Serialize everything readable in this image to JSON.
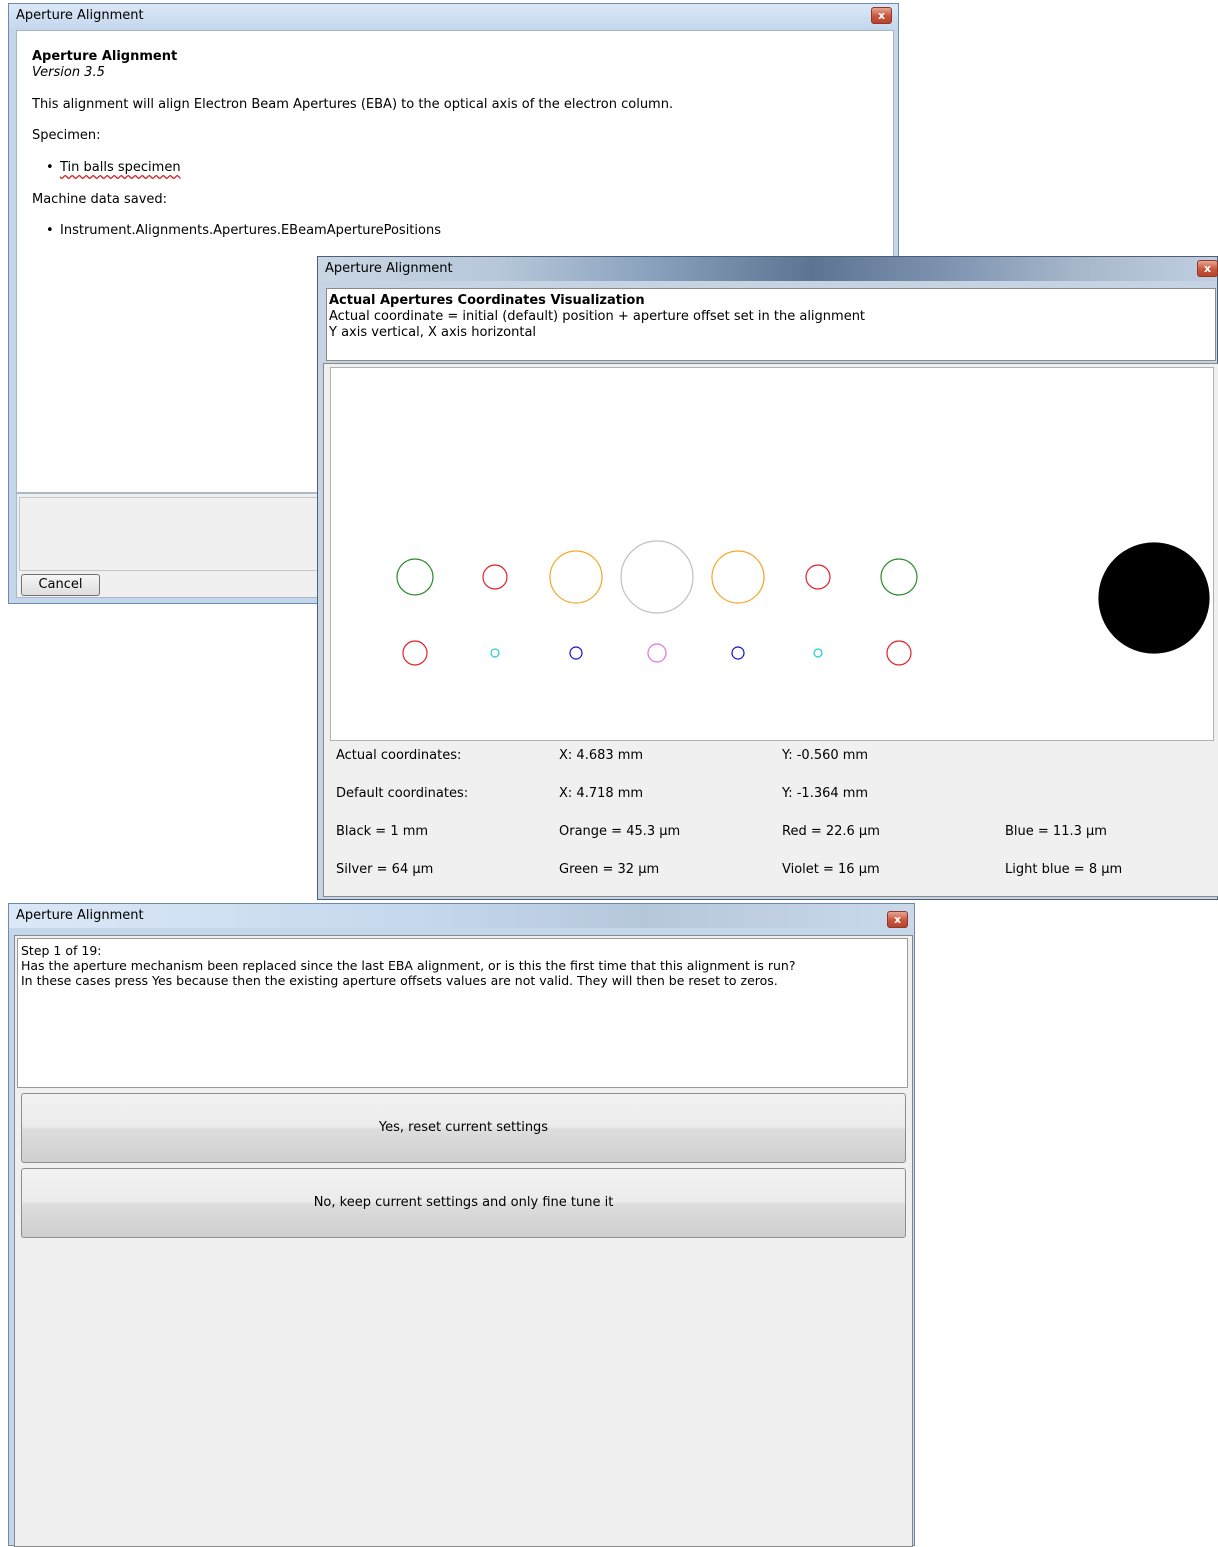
{
  "window1": {
    "title": "Aperture Alignment",
    "close_glyph": "x",
    "heading": "Aperture Alignment",
    "version": "Version 3.5",
    "description": "This alignment will align Electron Beam Apertures (EBA) to the optical axis of the electron column.",
    "specimen_label": "Specimen:",
    "specimen_item": "Tin balls specimen",
    "machine_data_label": "Machine data saved:",
    "machine_data_item": "Instrument.Alignments.Apertures.EBeamAperturePositions",
    "cancel_label": "Cancel"
  },
  "window2": {
    "title": "Aperture Alignment",
    "close_glyph": "x",
    "header_title": "Actual Apertures Coordinates Visualization",
    "header_line1": "Actual coordinate = initial (default) position + aperture offset set in the alignment",
    "header_line2": "Y axis vertical, X axis horizontal",
    "actual_label": "Actual coordinates:",
    "actual_x": "X: 4.683 mm",
    "actual_y": "Y: -0.560 mm",
    "default_label": "Default coordinates:",
    "default_x": "X: 4.718 mm",
    "default_y": "Y: -1.364 mm",
    "legend": [
      "Black = 1 mm",
      "Orange = 45.3 µm",
      "Red = 22.6 µm",
      "Blue = 11.3 µm",
      "Silver = 64 µm",
      "Green = 32 µm",
      "Violet = 16 µm",
      "Light blue = 8 µm"
    ],
    "colors": {
      "black": "#000000",
      "orange": "#f5a623",
      "red": "#e0202a",
      "blue": "#1010d0",
      "silver": "#c0c0c0",
      "green": "#2a8a2a",
      "violet": "#e070e0",
      "light_blue": "#20d0d0"
    },
    "apertures_row1": [
      "green",
      "red",
      "orange",
      "silver",
      "orange",
      "red",
      "green"
    ],
    "apertures_row2": [
      "red",
      "light_blue",
      "blue",
      "violet",
      "blue",
      "light_blue",
      "red"
    ]
  },
  "window3": {
    "title": "Aperture Alignment",
    "close_glyph": "x",
    "message": "Step 1 of 19:\nHas the aperture mechanism been replaced since the last EBA alignment, or is this the first time that this alignment is run?\nIn these cases press Yes because then the existing aperture offsets values are not valid. They will then be reset to zeros.",
    "yes_label": "Yes, reset current settings",
    "no_label": "No, keep current settings and only fine tune it"
  }
}
